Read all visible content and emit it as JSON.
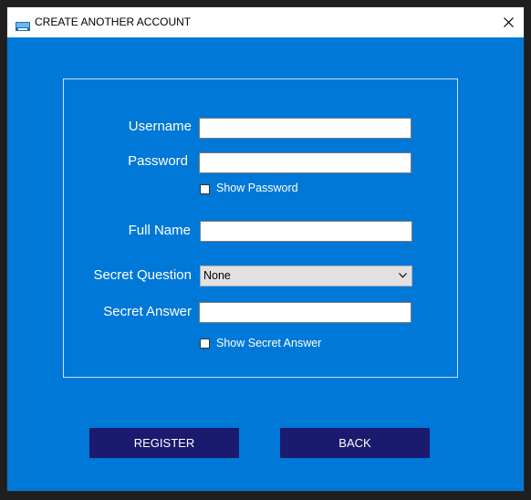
{
  "window": {
    "title": "CREATE ANOTHER ACCOUNT",
    "icon": "app-window-icon",
    "accent_color": "#0078d7"
  },
  "form": {
    "username_label": "Username",
    "username_value": "",
    "password_label": "Password",
    "password_value": "",
    "show_password_label": "Show Password",
    "show_password_checked": false,
    "full_name_label": "Full Name",
    "full_name_value": "",
    "secret_question_label": "Secret Question",
    "secret_question_selected": "None",
    "secret_answer_label": "Secret Answer",
    "secret_answer_value": "",
    "show_secret_answer_label": "Show Secret Answer",
    "show_secret_answer_checked": false
  },
  "buttons": {
    "register_label": "REGISTER",
    "back_label": "BACK",
    "button_color": "#1a1a6e"
  }
}
